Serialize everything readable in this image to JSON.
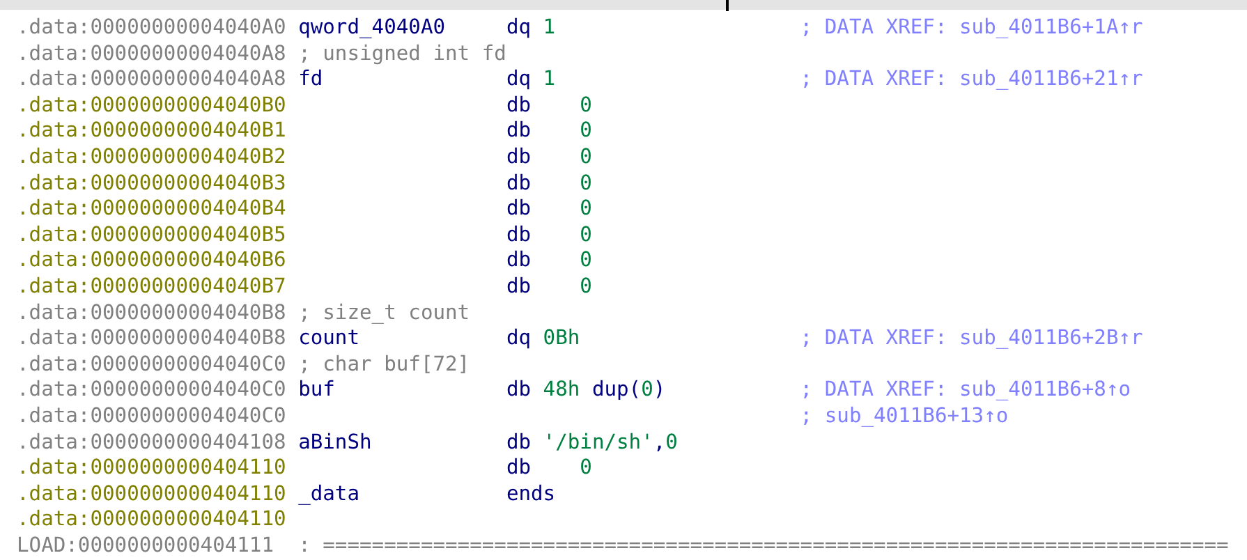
{
  "rows": [
    {
      "kind": "defined",
      "address": ".data:00000000004040A0",
      "label": "qword_4040A0",
      "mnemonic": "dq",
      "padded": false,
      "operand": [
        {
          "text": "1",
          "kind": "num"
        }
      ],
      "xref": "; DATA XREF: sub_4011B6+1A↑r"
    },
    {
      "kind": "defined",
      "address": ".data:00000000004040A8",
      "comment": "; unsigned int fd"
    },
    {
      "kind": "defined",
      "address": ".data:00000000004040A8",
      "label": "fd",
      "mnemonic": "dq",
      "padded": false,
      "operand": [
        {
          "text": "1",
          "kind": "num"
        }
      ],
      "xref": "; DATA XREF: sub_4011B6+21↑r"
    },
    {
      "kind": "unexplored",
      "address": ".data:00000000004040B0",
      "mnemonic": "db",
      "padded": true,
      "operand": [
        {
          "text": "0",
          "kind": "num"
        }
      ]
    },
    {
      "kind": "unexplored",
      "address": ".data:00000000004040B1",
      "mnemonic": "db",
      "padded": true,
      "operand": [
        {
          "text": "0",
          "kind": "num"
        }
      ]
    },
    {
      "kind": "unexplored",
      "address": ".data:00000000004040B2",
      "mnemonic": "db",
      "padded": true,
      "operand": [
        {
          "text": "0",
          "kind": "num"
        }
      ]
    },
    {
      "kind": "unexplored",
      "address": ".data:00000000004040B3",
      "mnemonic": "db",
      "padded": true,
      "operand": [
        {
          "text": "0",
          "kind": "num"
        }
      ]
    },
    {
      "kind": "unexplored",
      "address": ".data:00000000004040B4",
      "mnemonic": "db",
      "padded": true,
      "operand": [
        {
          "text": "0",
          "kind": "num"
        }
      ]
    },
    {
      "kind": "unexplored",
      "address": ".data:00000000004040B5",
      "mnemonic": "db",
      "padded": true,
      "operand": [
        {
          "text": "0",
          "kind": "num"
        }
      ]
    },
    {
      "kind": "unexplored",
      "address": ".data:00000000004040B6",
      "mnemonic": "db",
      "padded": true,
      "operand": [
        {
          "text": "0",
          "kind": "num"
        }
      ]
    },
    {
      "kind": "unexplored",
      "address": ".data:00000000004040B7",
      "mnemonic": "db",
      "padded": true,
      "operand": [
        {
          "text": "0",
          "kind": "num"
        }
      ]
    },
    {
      "kind": "defined",
      "address": ".data:00000000004040B8",
      "comment": "; size_t count"
    },
    {
      "kind": "defined",
      "address": ".data:00000000004040B8",
      "label": "count",
      "mnemonic": "dq",
      "padded": false,
      "operand": [
        {
          "text": "0Bh",
          "kind": "num"
        }
      ],
      "xref": "; DATA XREF: sub_4011B6+2B↑r"
    },
    {
      "kind": "defined",
      "address": ".data:00000000004040C0",
      "comment": "; char buf[72]"
    },
    {
      "kind": "defined",
      "address": ".data:00000000004040C0",
      "label": "buf",
      "mnemonic": "db",
      "padded": false,
      "operand": [
        {
          "text": "48h",
          "kind": "num"
        },
        {
          "text": " dup(",
          "kind": "sym"
        },
        {
          "text": "0",
          "kind": "num"
        },
        {
          "text": ")",
          "kind": "sym"
        }
      ],
      "xref": "; DATA XREF: sub_4011B6+8↑o"
    },
    {
      "kind": "defined",
      "address": ".data:00000000004040C0",
      "xref": "; sub_4011B6+13↑o"
    },
    {
      "kind": "defined",
      "address": ".data:0000000000404108",
      "label": "aBinSh",
      "mnemonic": "db",
      "padded": false,
      "operand": [
        {
          "text": "'/bin/sh'",
          "kind": "num"
        },
        {
          "text": ",",
          "kind": "sym"
        },
        {
          "text": "0",
          "kind": "num"
        }
      ]
    },
    {
      "kind": "unexplored",
      "address": ".data:0000000000404110",
      "mnemonic": "db",
      "padded": true,
      "operand": [
        {
          "text": "0",
          "kind": "num"
        }
      ]
    },
    {
      "kind": "unexplored",
      "address": ".data:0000000000404110",
      "label": "_data",
      "mnemonic": "ends"
    },
    {
      "kind": "unexplored",
      "address": ".data:0000000000404110"
    },
    {
      "kind": "defined",
      "address": "LOAD:0000000000404111",
      "separator": ": =========================================================================="
    }
  ]
}
